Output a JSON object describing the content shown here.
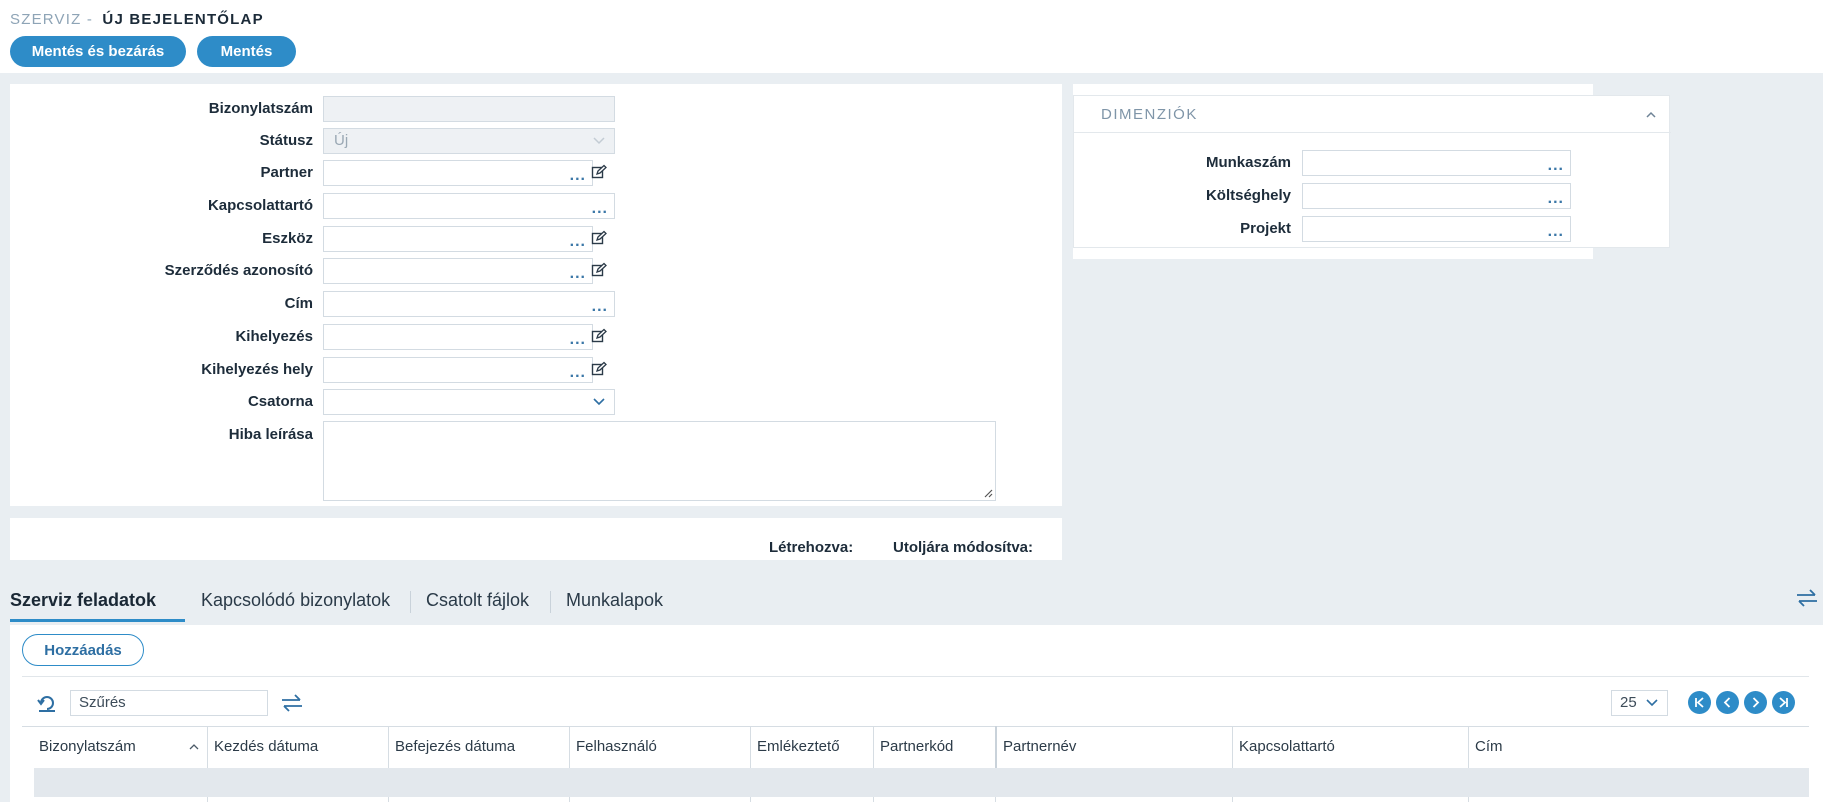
{
  "header": {
    "module": "SZERVIZ -",
    "page_title": "ÚJ BEJELENTŐLAP",
    "save_close_label": "Mentés és bezárás",
    "save_label": "Mentés"
  },
  "form": {
    "fields": [
      {
        "label": "Bizonylatszám",
        "value": ""
      },
      {
        "label": "Státusz",
        "value": "Új"
      },
      {
        "label": "Partner",
        "value": ""
      },
      {
        "label": "Kapcsolattartó",
        "value": ""
      },
      {
        "label": "Eszköz",
        "value": ""
      },
      {
        "label": "Szerződés azonosító",
        "value": ""
      },
      {
        "label": "Cím",
        "value": ""
      },
      {
        "label": "Kihelyezés",
        "value": ""
      },
      {
        "label": "Kihelyezés hely",
        "value": ""
      },
      {
        "label": "Csatorna",
        "value": ""
      },
      {
        "label": "Hiba leírása",
        "value": ""
      }
    ],
    "browse_glyph": "...",
    "icons": {
      "browse": "ellipsis-icon",
      "edit": "edit-icon",
      "dropdown": "chevron-down-icon"
    }
  },
  "dimensions": {
    "title": "DIMENZIÓK",
    "fields": [
      {
        "label": "Munkaszám",
        "value": ""
      },
      {
        "label": "Költséghely",
        "value": ""
      },
      {
        "label": "Projekt",
        "value": ""
      }
    ]
  },
  "record_info": {
    "created_label": "Létrehozva:",
    "modified_label": "Utoljára módosítva:"
  },
  "tabs": [
    {
      "label": "Szerviz feladatok",
      "active": true
    },
    {
      "label": "Kapcsolódó bizonylatok",
      "active": false
    },
    {
      "label": "Csatolt fájlok",
      "active": false
    },
    {
      "label": "Munkalapok",
      "active": false
    }
  ],
  "grid": {
    "add_label": "Hozzáadás",
    "filter_placeholder": "Szűrés",
    "page_size": "25",
    "columns": [
      "Bizonylatszám",
      "Kezdés dátuma",
      "Befejezés dátuma",
      "Felhasználó",
      "Emlékeztető",
      "Partnerkód",
      "Partnernév",
      "Kapcsolattartó",
      "Cím"
    ]
  },
  "colors": {
    "accent": "#2e8cc8",
    "background": "#e9eef2",
    "panel": "#ffffff"
  }
}
